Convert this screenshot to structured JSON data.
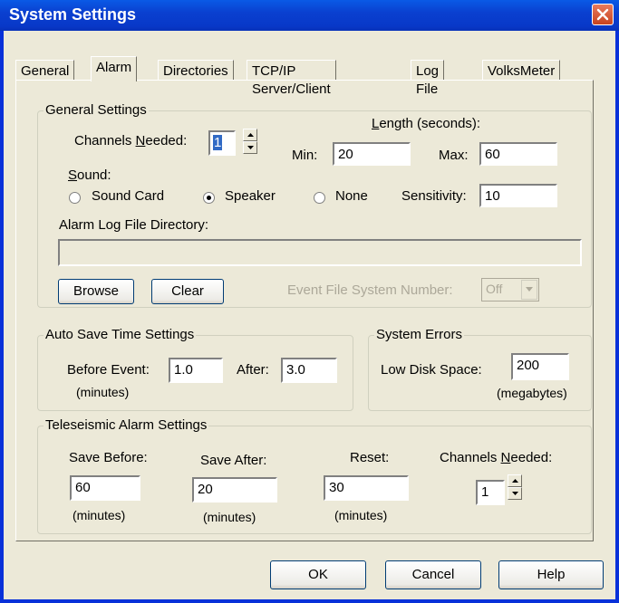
{
  "window": {
    "title": "System Settings"
  },
  "tabs": [
    "General",
    "Alarm",
    "Directories",
    "TCP/IP Server/Client",
    "Log File",
    "VolksMeter"
  ],
  "general_settings": {
    "title": "General Settings",
    "channels_needed_label_pre": "Channels ",
    "channels_needed_label_u": "N",
    "channels_needed_label_post": "eeded:",
    "channels_needed_value": "1",
    "length_label_u": "L",
    "length_label_post": "ength (seconds):",
    "min_label": "Min:",
    "min_value": "20",
    "max_label": "Max:",
    "max_value": "60",
    "sound_label_u": "S",
    "sound_label_post": "ound:",
    "sound_options": [
      "Sound Card",
      "Speaker",
      "None"
    ],
    "sound_selected": "Speaker",
    "sensitivity_label": "Sensitivity:",
    "sensitivity_value": "10",
    "log_dir_label": "Alarm Log File Directory:",
    "log_dir_value": "",
    "browse_label": "Browse",
    "clear_label": "Clear",
    "event_fs_label": "Event File System Number:",
    "event_fs_value": "Off"
  },
  "auto_save": {
    "title": "Auto Save Time Settings",
    "before_label": "Before Event:",
    "before_value": "1.0",
    "after_label": "After:",
    "after_value": "3.0",
    "units": "(minutes)"
  },
  "system_errors": {
    "title": "System Errors",
    "low_disk_label": "Low Disk Space:",
    "low_disk_value": "200",
    "units": "(megabytes)"
  },
  "teleseismic": {
    "title": "Teleseismic Alarm Settings",
    "save_before_label": "Save Before:",
    "save_before_value": "60",
    "save_after_label": "Save After:",
    "save_after_value": "20",
    "reset_label": "Reset:",
    "reset_value": "30",
    "channels_label_pre": "Channels ",
    "channels_label_u": "N",
    "channels_label_post": "eeded:",
    "channels_value": "1",
    "units": "(minutes)"
  },
  "buttons": {
    "ok": "OK",
    "cancel": "Cancel",
    "help": "Help"
  }
}
